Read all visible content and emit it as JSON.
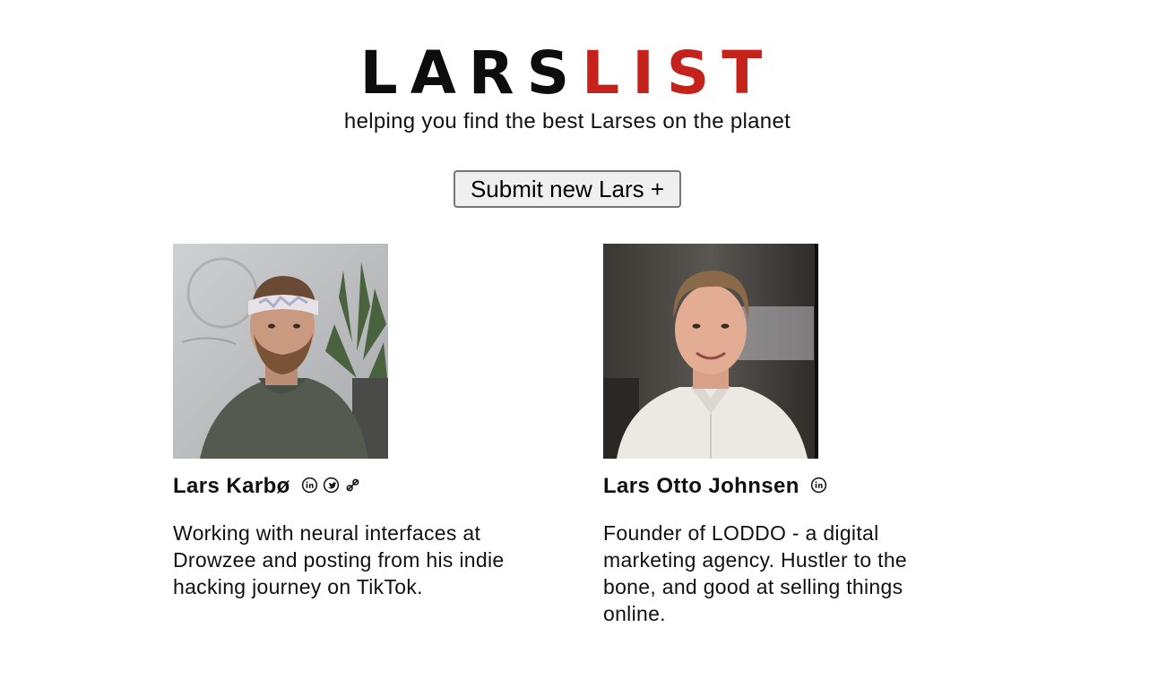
{
  "header": {
    "logo_part_a": "LARS",
    "logo_part_b": "LIST",
    "tagline": "helping you find the best Larses on the planet",
    "submit_label": "Submit new Lars +"
  },
  "colors": {
    "logo_dark": "#0d0d0d",
    "logo_accent": "#c4221b",
    "button_bg": "#efefef",
    "button_border": "#767676"
  },
  "cards": [
    {
      "name": "Lars Karbø",
      "bio": "Working with neural interfaces at Drowzee and posting from his indie hacking journey on TikTok.",
      "icons": [
        "linkedin-icon",
        "twitter-icon",
        "website-link-icon"
      ],
      "photo": "portrait of bearded man wearing a headband and green hoodie"
    },
    {
      "name": "Lars Otto Johnsen",
      "bio": "Founder of LODDO - a digital marketing agency. Hustler to the bone, and good at selling things online.",
      "icons": [
        "linkedin-icon"
      ],
      "photo": "portrait of smiling man in white shirt"
    }
  ]
}
